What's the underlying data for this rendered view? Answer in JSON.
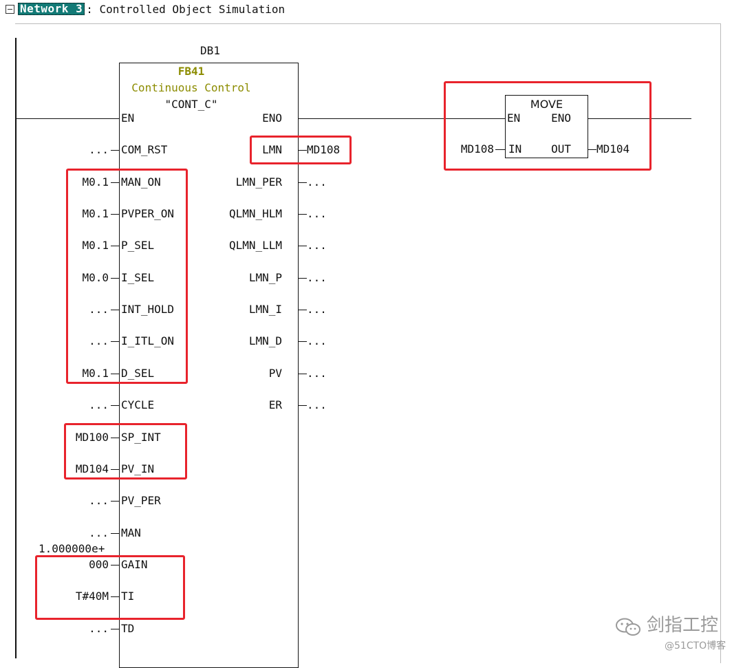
{
  "network": {
    "badge": "Network 3",
    "title": ": Controlled Object Simulation"
  },
  "fb": {
    "db": "DB1",
    "name": "FB41",
    "desc": "Continuous Control",
    "sym": "\"CONT_C\"",
    "in_pins": [
      {
        "pin": "EN",
        "value": ""
      },
      {
        "pin": "COM_RST",
        "value": "..."
      },
      {
        "pin": "MAN_ON",
        "value": "M0.1"
      },
      {
        "pin": "PVPER_ON",
        "value": "M0.1"
      },
      {
        "pin": "P_SEL",
        "value": "M0.1"
      },
      {
        "pin": "I_SEL",
        "value": "M0.0"
      },
      {
        "pin": "INT_HOLD",
        "value": "..."
      },
      {
        "pin": "I_ITL_ON",
        "value": "..."
      },
      {
        "pin": "D_SEL",
        "value": "M0.1"
      },
      {
        "pin": "CYCLE",
        "value": "..."
      },
      {
        "pin": "SP_INT",
        "value": "MD100"
      },
      {
        "pin": "PV_IN",
        "value": "MD104"
      },
      {
        "pin": "PV_PER",
        "value": "..."
      },
      {
        "pin": "MAN",
        "value": "..."
      },
      {
        "pin": "GAIN",
        "value": "000",
        "value_top": "1.000000e+"
      },
      {
        "pin": "TI",
        "value": "T#40M"
      },
      {
        "pin": "TD",
        "value": "..."
      }
    ],
    "out_pins": [
      {
        "pin": "ENO",
        "value": ""
      },
      {
        "pin": "LMN",
        "value": "MD108"
      },
      {
        "pin": "LMN_PER",
        "value": "..."
      },
      {
        "pin": "QLMN_HLM",
        "value": "..."
      },
      {
        "pin": "QLMN_LLM",
        "value": "..."
      },
      {
        "pin": "LMN_P",
        "value": "..."
      },
      {
        "pin": "LMN_I",
        "value": "..."
      },
      {
        "pin": "LMN_D",
        "value": "..."
      },
      {
        "pin": "PV",
        "value": "..."
      },
      {
        "pin": "ER",
        "value": "..."
      }
    ]
  },
  "move": {
    "title": "MOVE",
    "en": "EN",
    "eno": "ENO",
    "in_pin": "IN",
    "out_pin": "OUT",
    "in_value": "MD108",
    "out_value": "MD104"
  },
  "watermark": {
    "brand": "剑指工控",
    "site": "@51CTO博客"
  },
  "colors": {
    "highlight": "#e8232c",
    "badge": "#127a76",
    "fb_title": "#8c8c00"
  }
}
